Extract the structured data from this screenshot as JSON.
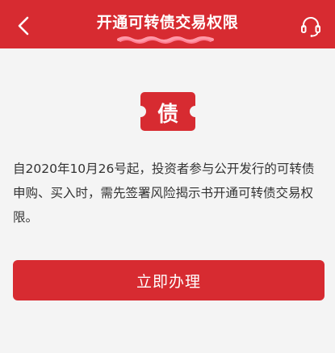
{
  "header": {
    "title": "开通可转债交易权限",
    "back_icon": "chevron-left-icon",
    "service_icon": "headset-icon",
    "background_color": "#d72b31"
  },
  "badge": {
    "text": "债",
    "icon": "ticket-icon",
    "color": "#d72b31"
  },
  "notice": {
    "text": "自2020年10月26号起，投资者参与公开发行的可转债申购、买入时，需先签署风险揭示书开通可转债交易权限。"
  },
  "action": {
    "button_label": "立即办理",
    "button_color": "#d72b31"
  }
}
